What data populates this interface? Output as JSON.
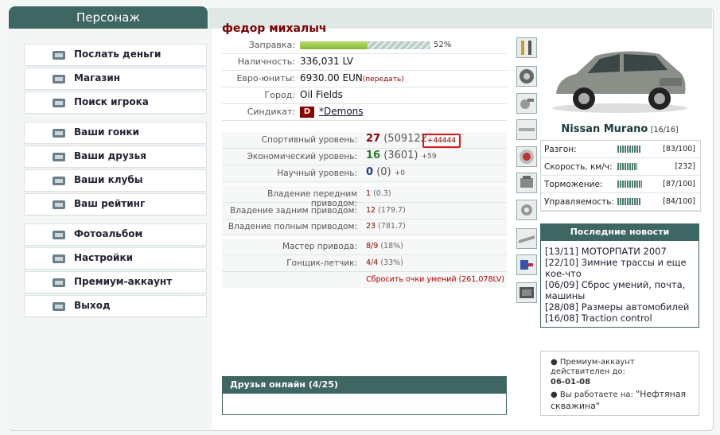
{
  "header": {
    "tab_title": "Персонаж"
  },
  "menu": [
    {
      "label": "Послать деньги",
      "icon": "money-icon"
    },
    {
      "label": "Магазин",
      "icon": "shop-icon"
    },
    {
      "label": "Поиск игрока",
      "icon": "search-icon"
    },
    {
      "label": "Ваши гонки",
      "icon": "steering-wheel-icon"
    },
    {
      "label": "Ваши друзья",
      "icon": "friends-icon"
    },
    {
      "label": "Ваши клубы",
      "icon": "clubs-icon"
    },
    {
      "label": "Ваш рейтинг",
      "icon": "rating-icon"
    },
    {
      "label": "Фотоальбом",
      "icon": "camera-icon"
    },
    {
      "label": "Настройки",
      "icon": "settings-icon"
    },
    {
      "label": "Премиум-аккаунт",
      "icon": "premium-icon"
    },
    {
      "label": "Выход",
      "icon": "exit-icon"
    }
  ],
  "profile": {
    "name": "федор михалыч",
    "fuel_label": "Заправка:",
    "fuel_percent": 52,
    "fuel_text": "52%",
    "cash_label": "Наличность:",
    "cash_value": "336,031 LV",
    "euro_label": "Евро-юниты:",
    "euro_value": "6930.00 EUN",
    "euro_link": "(передать)",
    "city_label": "Город:",
    "city_value": "Oil Fields",
    "syndicate_label": "Синдикат:",
    "syndicate_badge": "D",
    "syndicate_value": "*Demons"
  },
  "levels": {
    "sport_label": "Спортивный уровень:",
    "sport_level": "27",
    "sport_points": "(509122",
    "sport_delta": "+44444",
    "econ_label": "Экономический уровень:",
    "econ_level": "16",
    "econ_points": "(3601)",
    "econ_delta": "+59",
    "sci_label": "Научный уровень:",
    "sci_level": "0",
    "sci_points": "(0)",
    "sci_delta": "+0"
  },
  "drives": {
    "front_label": "Владение передним приводом:",
    "front_value": "1",
    "front_pct": "(0.3)",
    "rear_label": "Владение задним приводом:",
    "rear_value": "12",
    "rear_pct": "(179.7)",
    "all_label": "Владение полным приводом:",
    "all_value": "23",
    "all_pct": "(781.7)"
  },
  "masters": {
    "drive_master_label": "Мастер привода:",
    "drive_master_value": "8/9",
    "drive_master_pct": "(18%)",
    "pilot_label": "Гонщик-летчик:",
    "pilot_value": "4/4",
    "pilot_pct": "(33%)",
    "reset_link": "Сбросить очки умений (261,078LV)"
  },
  "car": {
    "name": "Nissan Murano",
    "count": "[16/16]",
    "stats": [
      {
        "label": "Разгон:",
        "value": "[83/100]",
        "level": 0.83
      },
      {
        "label": "Скорость, км/ч:",
        "value": "[232]",
        "level": 0.7
      },
      {
        "label": "Торможение:",
        "value": "[87/100]",
        "level": 0.87
      },
      {
        "label": "Управляемость:",
        "value": "[84/100]",
        "level": 0.84
      }
    ]
  },
  "news": {
    "title": "Последние новости",
    "items": [
      "[13/11] МОТОРПАТИ 2007",
      "[22/10] Зимние трассы и еще кое-что",
      "[06/09] Сброс умений, почта, машины",
      "[28/08] Размеры автомобилей",
      "[16/08] Traction control"
    ]
  },
  "premium": {
    "line1": "Премиум-аккаунт действителен до:",
    "date": "06-01-08",
    "line2": "Вы работаете на:",
    "job": "\"Нефтяная скважина\""
  },
  "friends": {
    "title": "Друзья онлайн (4/25)"
  },
  "colors": {
    "accent": "#3e6663",
    "red": "#8b0000",
    "green": "#2a7a2a"
  }
}
